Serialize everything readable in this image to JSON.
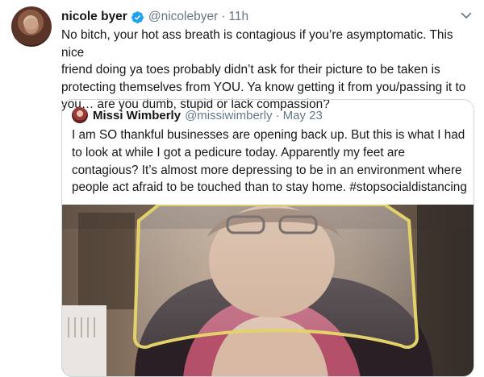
{
  "tweet": {
    "display_name": "nicole byer",
    "handle": "@nicolebyer",
    "separator": "·",
    "time": "11h",
    "verified": true,
    "text": "No bitch, your hot ass breath is contagious if you’re asymptomatic. This nice\nfriend doing ya toes probably didn’t ask for their picture to be taken is\nprotecting themselves from YOU. Ya know getting it from you/passing it to\nyou… are you dumb, stupid or lack compassion?"
  },
  "quote": {
    "display_name": "Missi Wimberly",
    "handle": "@missiwimberly",
    "separator": "·",
    "date": "May 23",
    "text": "I am SO thankful businesses are opening back up. But this is what I had\nto look at while I got a pedicure today. Apparently my feet are\ncontagious? It’s almost more depressing to be in an environment where\npeople act afraid to be touched than to stay home. #stopsocialdistancing"
  },
  "icons": {
    "verified": "verified-badge-icon",
    "menu": "chevron-down-icon"
  },
  "colors": {
    "text": "#14171a",
    "secondary": "#657786",
    "verified_blue": "#1da1f2",
    "border": "#ccd6dd"
  }
}
